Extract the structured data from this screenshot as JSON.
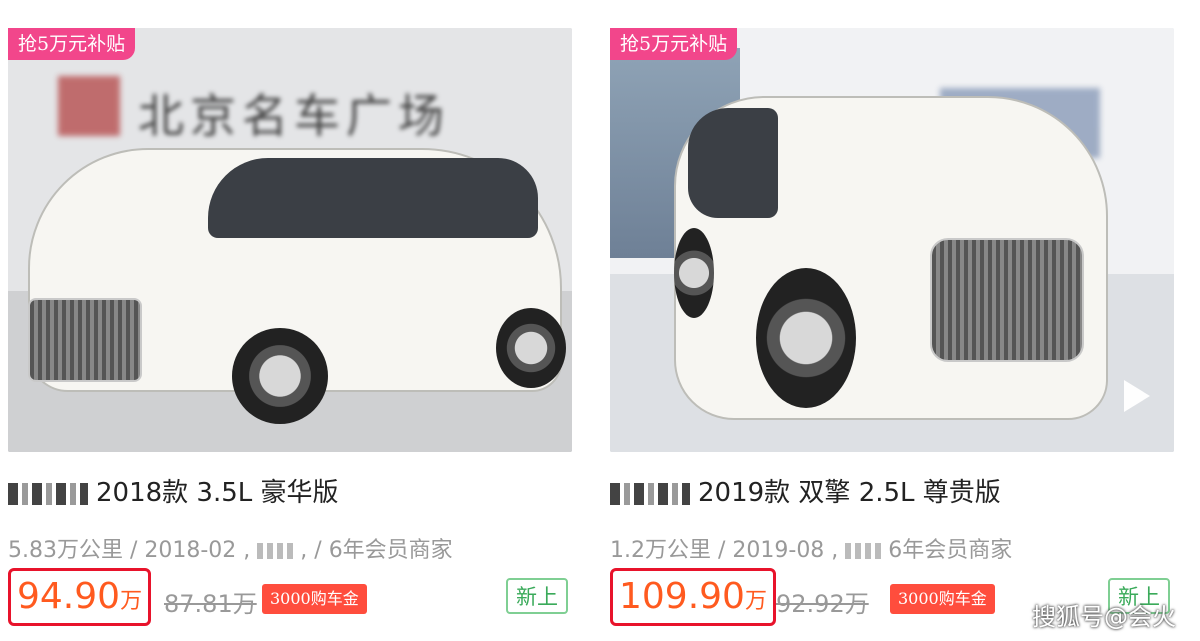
{
  "listings": [
    {
      "badge": "抢5万元补贴",
      "title": "2018款 3.5L 豪华版",
      "meta_mileage": "5.83万公里 / 2018-02 ,",
      "meta_member": ", / 6年会员商家",
      "price": "94.90",
      "unit": "万",
      "old_price": "87.81万",
      "subsidy": "3000购车金",
      "new_tag": "新上",
      "store_sign": "北京名车广场"
    },
    {
      "badge": "抢5万元补贴",
      "title": "2019款 双擎 2.5L 尊贵版",
      "meta_mileage": "1.2万公里 / 2019-08 ,",
      "meta_member": "6年会员商家",
      "price": "109.90",
      "unit": "万",
      "old_price": "92.92万",
      "subsidy": "3000购车金",
      "new_tag": "新上"
    }
  ],
  "watermark": "搜狐号@会火",
  "colors": {
    "badge": "#f2468b",
    "price": "#ff5a1f",
    "highlight_box": "#e8132b",
    "subsidy": "#ff4d3d",
    "new_tag": "#3aaa5a"
  },
  "icons": {
    "video": "play-icon"
  }
}
